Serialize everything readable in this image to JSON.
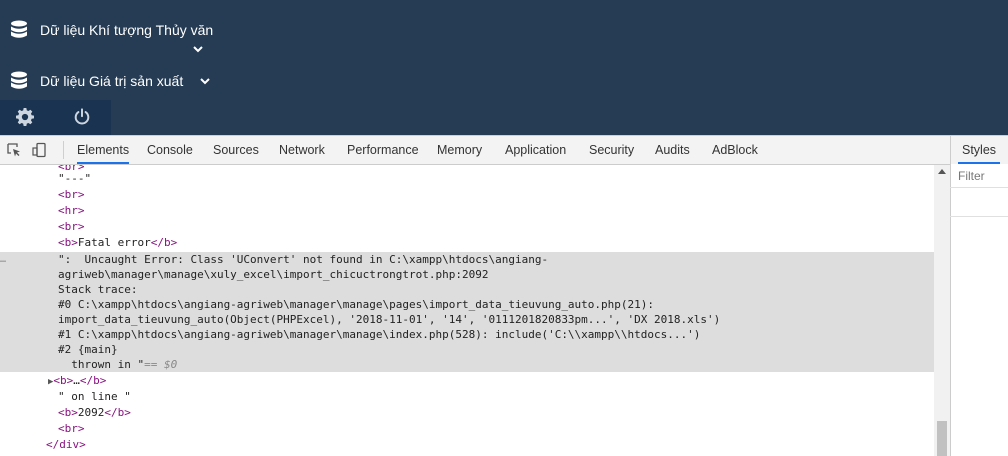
{
  "app": {
    "nav_items": [
      {
        "label": "Dữ liệu Khí tượng Thủy văn",
        "icon": "database-icon"
      },
      {
        "label": "Dữ liệu Giá trị sản xuất",
        "icon": "database-icon"
      }
    ],
    "icons": [
      "gear-icon",
      "power-icon"
    ],
    "colors": {
      "header_bg": "#253c54",
      "icon_bar_bg": "#1a3350"
    }
  },
  "devtools": {
    "tabs": [
      "Elements",
      "Console",
      "Sources",
      "Network",
      "Performance",
      "Memory",
      "Application",
      "Security",
      "Audits",
      "AdBlock"
    ],
    "active_tab": "Elements",
    "side_panel": {
      "tab": "Styles",
      "filter_placeholder": "Filter"
    },
    "tree_lines": [
      {
        "text": "<br>",
        "kind": "tag"
      },
      {
        "text": "\"---\"",
        "kind": "str"
      },
      {
        "text": "<br>",
        "kind": "tag"
      },
      {
        "text": "<hr>",
        "kind": "tag"
      },
      {
        "text": "<br>",
        "kind": "tag"
      },
      {
        "open": "<b>",
        "inner": "Fatal error",
        "close": "</b>",
        "kind": "mixed"
      },
      {
        "text": "\":  Uncaught Error: Class 'UConvert' not found in C:\\xampp\\htdocs\\angiang-",
        "kind": "hl"
      },
      {
        "text": "agriweb\\manager\\manage\\xuly_excel\\import_chicuctrongtrot.php:2092",
        "kind": "hl"
      },
      {
        "text": "Stack trace:",
        "kind": "hl"
      },
      {
        "text": "#0 C:\\xampp\\htdocs\\angiang-agriweb\\manager\\manage\\pages\\import_data_tieuvung_auto.php(21):",
        "kind": "hl"
      },
      {
        "text": "import_data_tieuvung_auto(Object(PHPExcel), '2018-11-01', '14', '0111201820833pm...', 'DX 2018.xls')",
        "kind": "hl"
      },
      {
        "text": "#1 C:\\xampp\\htdocs\\angiang-agriweb\\manager\\manage\\index.php(528): include('C:\\\\xampp\\\\htdocs...')",
        "kind": "hl"
      },
      {
        "text": "#2 {main}",
        "kind": "hl"
      },
      {
        "text": "  thrown in \"",
        "eq": "== $0",
        "kind": "hl"
      },
      {
        "open": "<b>",
        "inner": "…",
        "close": "</b>",
        "kind": "collapsed"
      },
      {
        "text": "\" on line \"",
        "kind": "str"
      },
      {
        "open": "<b>",
        "inner": "2092",
        "close": "</b>",
        "kind": "mixed"
      },
      {
        "text": "<br>",
        "kind": "tag"
      },
      {
        "text": "</div>",
        "kind": "tag"
      }
    ],
    "dots": "…"
  }
}
